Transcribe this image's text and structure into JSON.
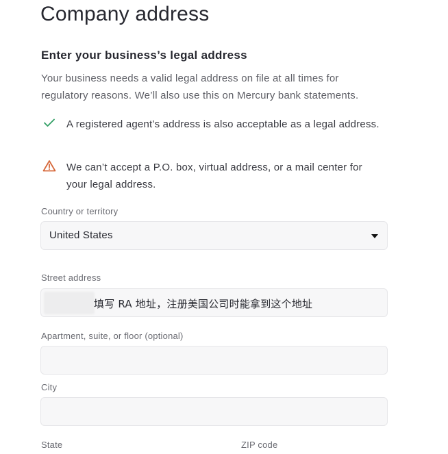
{
  "page": {
    "title": "Company address"
  },
  "section": {
    "heading": "Enter your business’s legal address",
    "description": "Your business needs a valid legal address on file at all times for regulatory reasons. We’ll also use this on Mercury bank statements."
  },
  "notes": [
    {
      "icon": "check-icon",
      "text": "A registered agent’s address is also acceptable as a legal address.",
      "color": "#2f9e63"
    },
    {
      "icon": "warning-icon",
      "text": "We can’t accept a P.O. box, virtual address, or a mail center for your legal address.",
      "color": "#d6683a"
    }
  ],
  "form": {
    "country": {
      "label": "Country or territory",
      "value": "United States"
    },
    "street": {
      "label": "Street address",
      "value": "填写 RA 地址，注册美国公司时能拿到这个地址"
    },
    "apartment": {
      "label": "Apartment, suite, or floor (optional)",
      "value": ""
    },
    "city": {
      "label": "City",
      "value": ""
    },
    "state": {
      "label": "State"
    },
    "zip": {
      "label": "ZIP code"
    }
  }
}
